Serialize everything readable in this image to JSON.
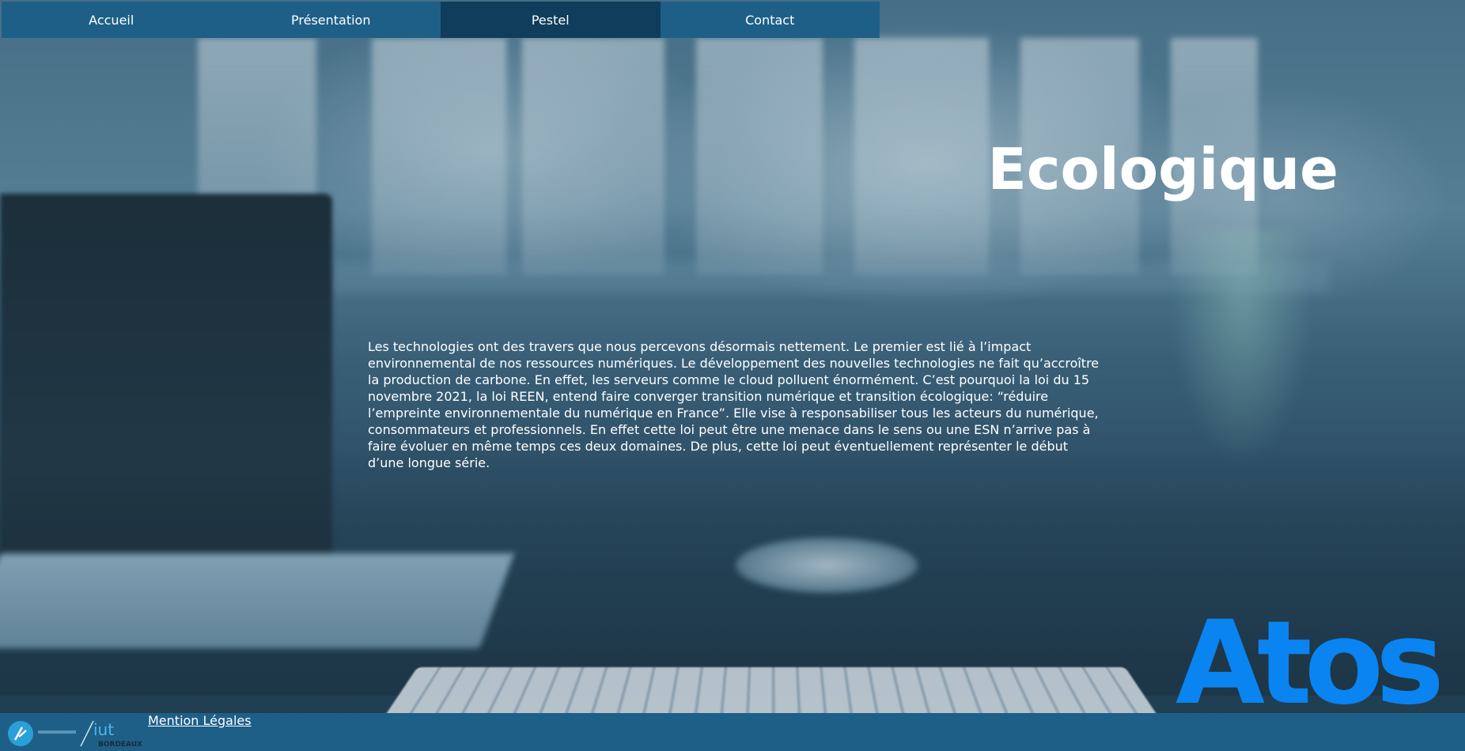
{
  "nav": {
    "items": [
      {
        "label": "Accueil"
      },
      {
        "label": "Présentation"
      },
      {
        "label": "Pestel"
      },
      {
        "label": "Contact"
      }
    ],
    "active": "Pestel"
  },
  "main": {
    "heading": "Ecologique",
    "paragraph": "Les technologies ont des travers que nous percevons désormais nettement. Le premier est lié à l’impact environnemental de nos ressources numériques. Le développement des nouvelles technologies ne fait qu’accroître la production de carbone. En effet, les serveurs comme le cloud polluent énormément. C’est pourquoi la loi du 15 novembre 2021, la loi REEN, entend faire converger transition numérique et transition écologique: “réduire l’empreinte environnementale du numérique en France”. Elle vise à responsabiliser tous les acteurs du numérique, consommateurs et professionnels. En effet cette loi peut être une menace dans le sens ou une ESN n’arrive pas à faire évoluer en même temps ces deux domaines. De plus, cette loi peut éventuellement représenter le début d’une longue série."
  },
  "brand": {
    "logo_text": "Atos",
    "logo_color": "#0a84f0"
  },
  "footer": {
    "legal_link": "Mention Légales",
    "iut_logo_text": "iut",
    "iut_logo_sub": "BORDEAUX"
  },
  "colors": {
    "nav_bg": "#1e5f88",
    "nav_active_bg": "#0f3d5b",
    "footer_bg": "#1e5f88"
  }
}
